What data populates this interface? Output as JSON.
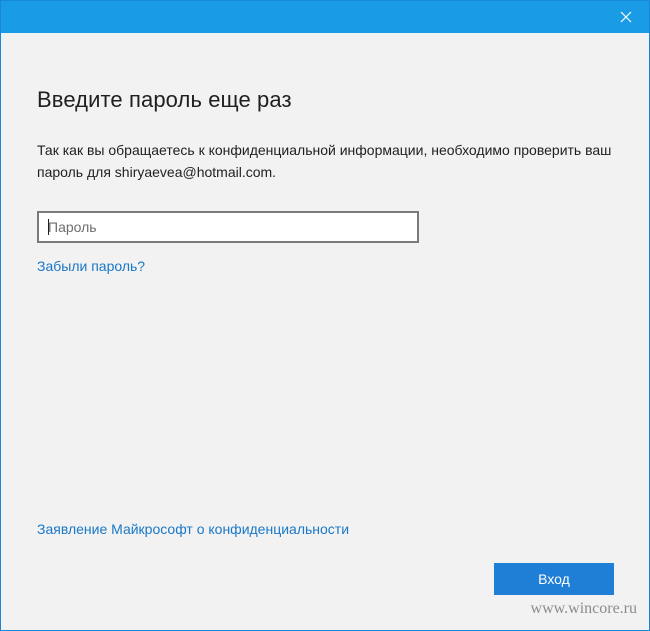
{
  "window": {
    "close_icon": "close-icon",
    "title_bar_color": "#1a9be6"
  },
  "dialog": {
    "heading": "Введите пароль еще раз",
    "description": "Так как вы обращаетесь к конфиденциальной информации, необходимо проверить ваш пароль для shiryaevea@hotmail.com.",
    "password_field": {
      "placeholder": "Пароль",
      "value": ""
    },
    "forgot_password_link": "Забыли пароль?",
    "privacy_link": "Заявление Майкрософт о конфиденциальности",
    "login_button": "Вход",
    "accent_color": "#1f7fd6",
    "link_color": "#1978c8"
  },
  "watermark": "www.wincore.ru"
}
